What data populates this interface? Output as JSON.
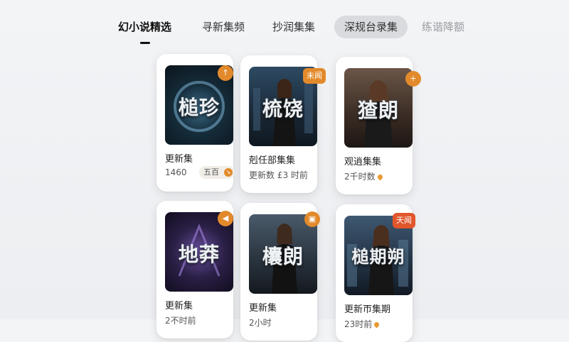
{
  "tabs": [
    {
      "label": "幻小说精选"
    },
    {
      "label": "寻新集频"
    },
    {
      "label": "抄润集集"
    },
    {
      "label": "深规台录集"
    },
    {
      "label": "练谐降额"
    }
  ],
  "cards": [
    {
      "poster_title": "槌珍",
      "badge": "↑",
      "name": "更新集",
      "meta": "1460",
      "chip": "五百",
      "chip_icon": "↘"
    },
    {
      "poster_title": "梳饶",
      "badge": "未闻",
      "name": "剋任部集集",
      "meta": "更新数  £3 时前"
    },
    {
      "poster_title": "猹朗",
      "badge": "+",
      "name": "观逍集集",
      "meta": "2千时数"
    },
    {
      "poster_title": "地莽",
      "badge": "◀",
      "name": "更新集",
      "meta": "2不时前"
    },
    {
      "poster_title": "欜朗",
      "badge": "▣",
      "name": "更新集",
      "meta": "2小时"
    },
    {
      "poster_title": "槌期朔",
      "badge": "天闻",
      "name": "更新帀集期",
      "meta": "23时前"
    }
  ],
  "colors": {
    "accent": "#e28a2b",
    "accent_red": "#e2562c"
  }
}
